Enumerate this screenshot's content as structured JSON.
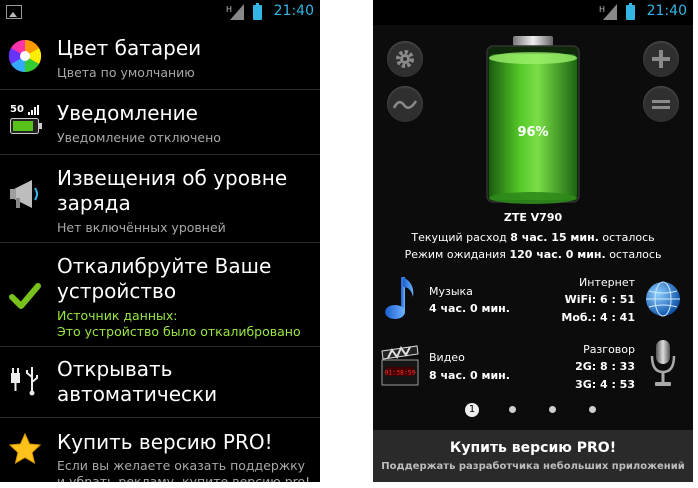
{
  "status": {
    "time": "21:40",
    "network": "H"
  },
  "left": {
    "items": [
      {
        "title": "Цвет батареи",
        "subtitle": "Цвета по умолчанию"
      },
      {
        "badge": "50",
        "title": "Уведомление",
        "subtitle": "Уведомление отключено"
      },
      {
        "title_1": "Извещения об уровне",
        "title_2": "заряда",
        "subtitle": "Нет включённых уровней"
      },
      {
        "title_1": "Откалибруйте Ваше",
        "title_2": "устройство",
        "subtitle_1": "Источник данных:",
        "subtitle_2": "Это устройство было откалибровано"
      },
      {
        "title_1": "Открывать",
        "title_2": "автоматически"
      },
      {
        "title": "Купить версию PRO!",
        "subtitle_1": "Если вы желаете оказать поддержку",
        "subtitle_2": "и убрать рекламу, купите версию pro!"
      }
    ]
  },
  "right": {
    "battery_percent": "96%",
    "battery_level": 0.96,
    "device": "ZTE V790",
    "usage": {
      "current_prefix": "Текущий расход",
      "current_value": "8 час. 15 мин.",
      "current_suffix": "осталось",
      "standby_prefix": "Режим ожидания",
      "standby_value": "120 час. 0 мин.",
      "standby_suffix": "осталось"
    },
    "music": {
      "label": "Музыка",
      "value": "4 час. 0 мин."
    },
    "video": {
      "label": "Видео",
      "value": "8 час. 0 мин.",
      "clapper_text": "01:38:59"
    },
    "internet": {
      "label": "Интернет",
      "wifi": "WiFi: 6 : 51",
      "mobile": "Моб.: 4 : 41"
    },
    "talk": {
      "label": "Разговор",
      "g2": "2G: 8 : 33",
      "g3": "3G: 4 : 53"
    },
    "pager": {
      "current": "1"
    },
    "buy": {
      "title": "Купить версию PRO!",
      "subtitle": "Поддержать разработчика небольших приложений"
    }
  }
}
